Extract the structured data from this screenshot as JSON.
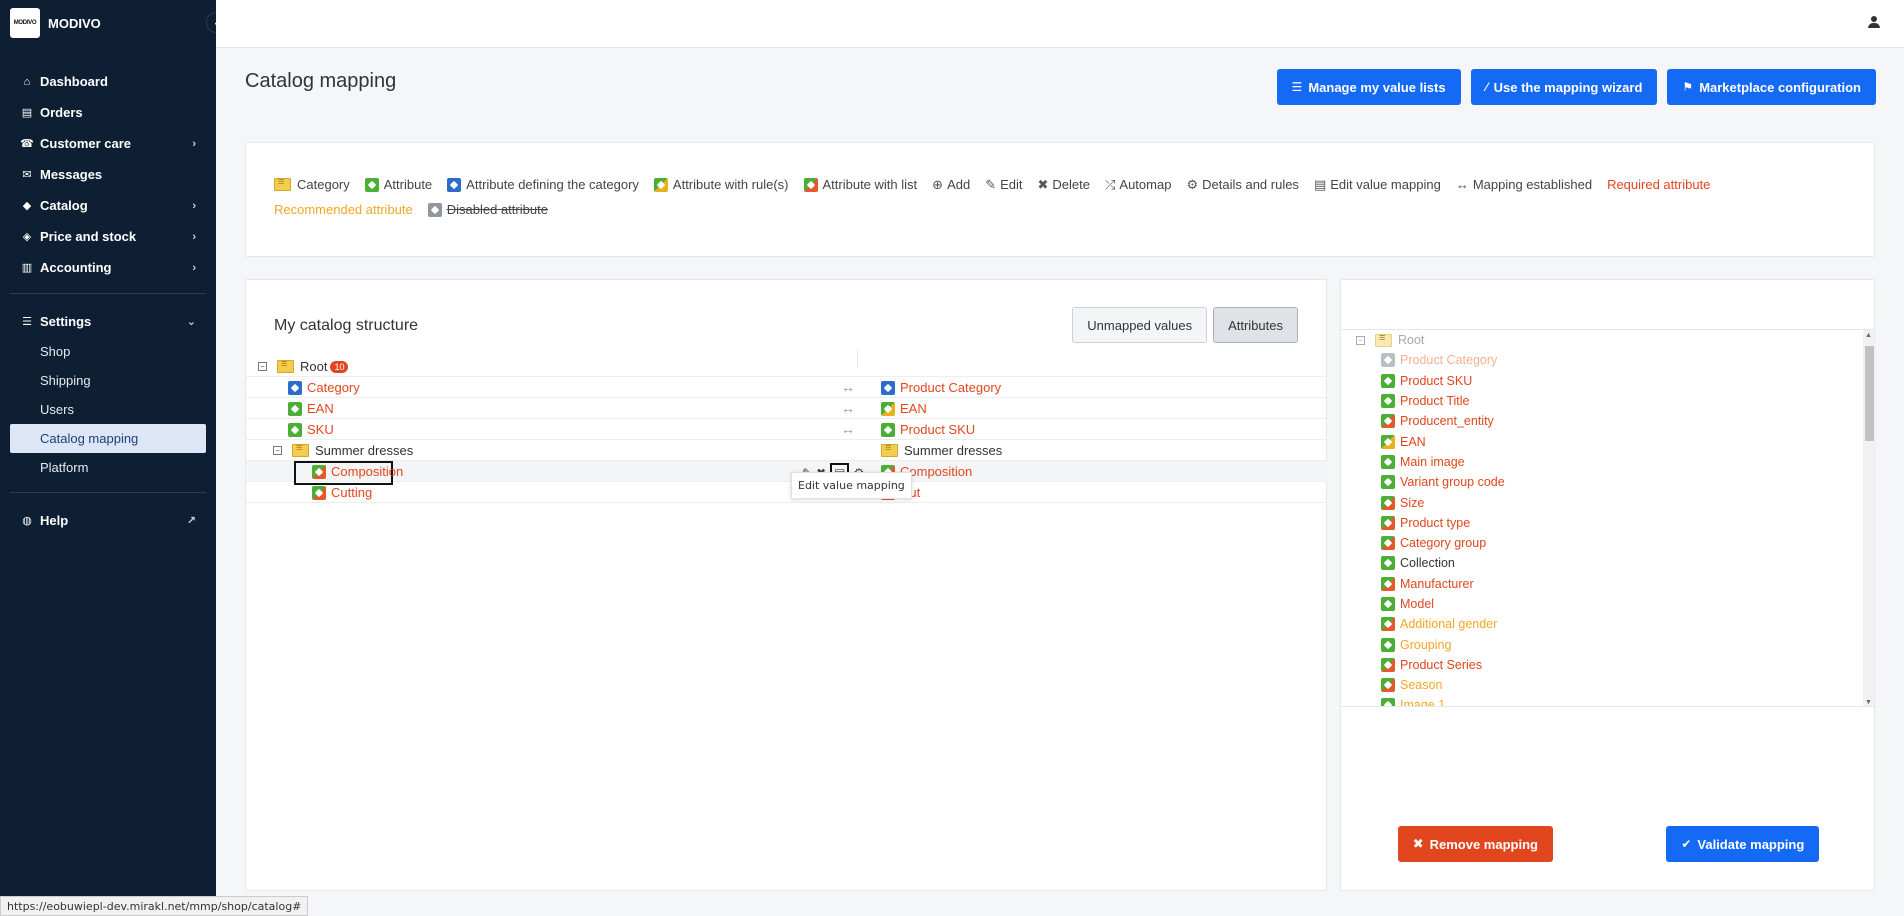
{
  "brand": {
    "logo_text": "MODIVO",
    "name": "MODIVO"
  },
  "nav": {
    "items": [
      {
        "label": "Dashboard",
        "icon": "home-icon",
        "glyph": "⌂"
      },
      {
        "label": "Orders",
        "icon": "clipboard-icon",
        "glyph": "▤"
      },
      {
        "label": "Customer care",
        "icon": "headset-icon",
        "glyph": "☎",
        "chevron": "›"
      },
      {
        "label": "Messages",
        "icon": "chat-icon",
        "glyph": "✉"
      },
      {
        "label": "Catalog",
        "icon": "shapes-icon",
        "glyph": "◆",
        "chevron": "›"
      },
      {
        "label": "Price and stock",
        "icon": "tag-icon",
        "glyph": "◈",
        "chevron": "›"
      },
      {
        "label": "Accounting",
        "icon": "invoice-icon",
        "glyph": "▥",
        "chevron": "›"
      }
    ],
    "settings": {
      "label": "Settings",
      "chevron": "⌄"
    },
    "settings_sub": [
      "Shop",
      "Shipping",
      "Users",
      "Catalog mapping",
      "Platform"
    ],
    "help": {
      "label": "Help"
    }
  },
  "status_url": "https://eobuwiepl-dev.mirakl.net/mmp/shop/catalog#",
  "page": {
    "title": "Catalog mapping",
    "buttons": {
      "value_lists": "Manage my value lists",
      "wizard": "Use the mapping wizard",
      "marketplace": "Marketplace configuration"
    }
  },
  "legend": {
    "category": "Category",
    "attribute": "Attribute",
    "attr_defining": "Attribute defining the category",
    "attr_rules": "Attribute with rule(s)",
    "attr_list": "Attribute with list",
    "add": "Add",
    "edit": "Edit",
    "delete": "Delete",
    "automap": "Automap",
    "details": "Details and rules",
    "edit_value": "Edit value mapping",
    "established": "Mapping established",
    "required": "Required attribute",
    "recommended": "Recommended attribute",
    "disabled": "Disabled attribute"
  },
  "structure": {
    "title": "My catalog structure",
    "toggle": {
      "unmapped": "Unmapped values",
      "attributes": "Attributes"
    },
    "root_label": "Root",
    "root_badge": "10",
    "rows": {
      "category": {
        "left": "Category",
        "right": "Product Category"
      },
      "ean": {
        "left": "EAN",
        "right": "EAN"
      },
      "sku": {
        "left": "SKU",
        "right": "Product SKU"
      },
      "summer": {
        "left": "Summer dresses",
        "right": "Summer dresses"
      },
      "composition": {
        "left": "Composition",
        "right": "Composition"
      },
      "cutting": {
        "left": "Cutting",
        "right": "Cut"
      }
    },
    "arrow": "↔",
    "tooltip": "Edit value mapping"
  },
  "target": {
    "root": "Root",
    "items": [
      {
        "label": "Product Category",
        "tag": "grey",
        "color": "pale"
      },
      {
        "label": "Product SKU",
        "tag": "green",
        "color": "red"
      },
      {
        "label": "Product Title",
        "tag": "green",
        "color": "red"
      },
      {
        "label": "Producent_entity",
        "tag": "list",
        "color": "red"
      },
      {
        "label": "EAN",
        "tag": "rule",
        "color": "red"
      },
      {
        "label": "Main image",
        "tag": "green",
        "color": "red"
      },
      {
        "label": "Variant group code",
        "tag": "green",
        "color": "red"
      },
      {
        "label": "Size",
        "tag": "list",
        "color": "red"
      },
      {
        "label": "Product type",
        "tag": "list",
        "color": "red"
      },
      {
        "label": "Category group",
        "tag": "list",
        "color": "red"
      },
      {
        "label": "Collection",
        "tag": "green",
        "color": "dark"
      },
      {
        "label": "Manufacturer",
        "tag": "list",
        "color": "red"
      },
      {
        "label": "Model",
        "tag": "green",
        "color": "red"
      },
      {
        "label": "Additional gender",
        "tag": "list",
        "color": "orange"
      },
      {
        "label": "Grouping",
        "tag": "green",
        "color": "orange"
      },
      {
        "label": "Product Series",
        "tag": "list",
        "color": "red"
      },
      {
        "label": "Season",
        "tag": "list",
        "color": "orange"
      },
      {
        "label": "Image 1",
        "tag": "green",
        "color": "orange"
      }
    ],
    "buttons": {
      "remove": "Remove mapping",
      "validate": "Validate mapping"
    }
  }
}
